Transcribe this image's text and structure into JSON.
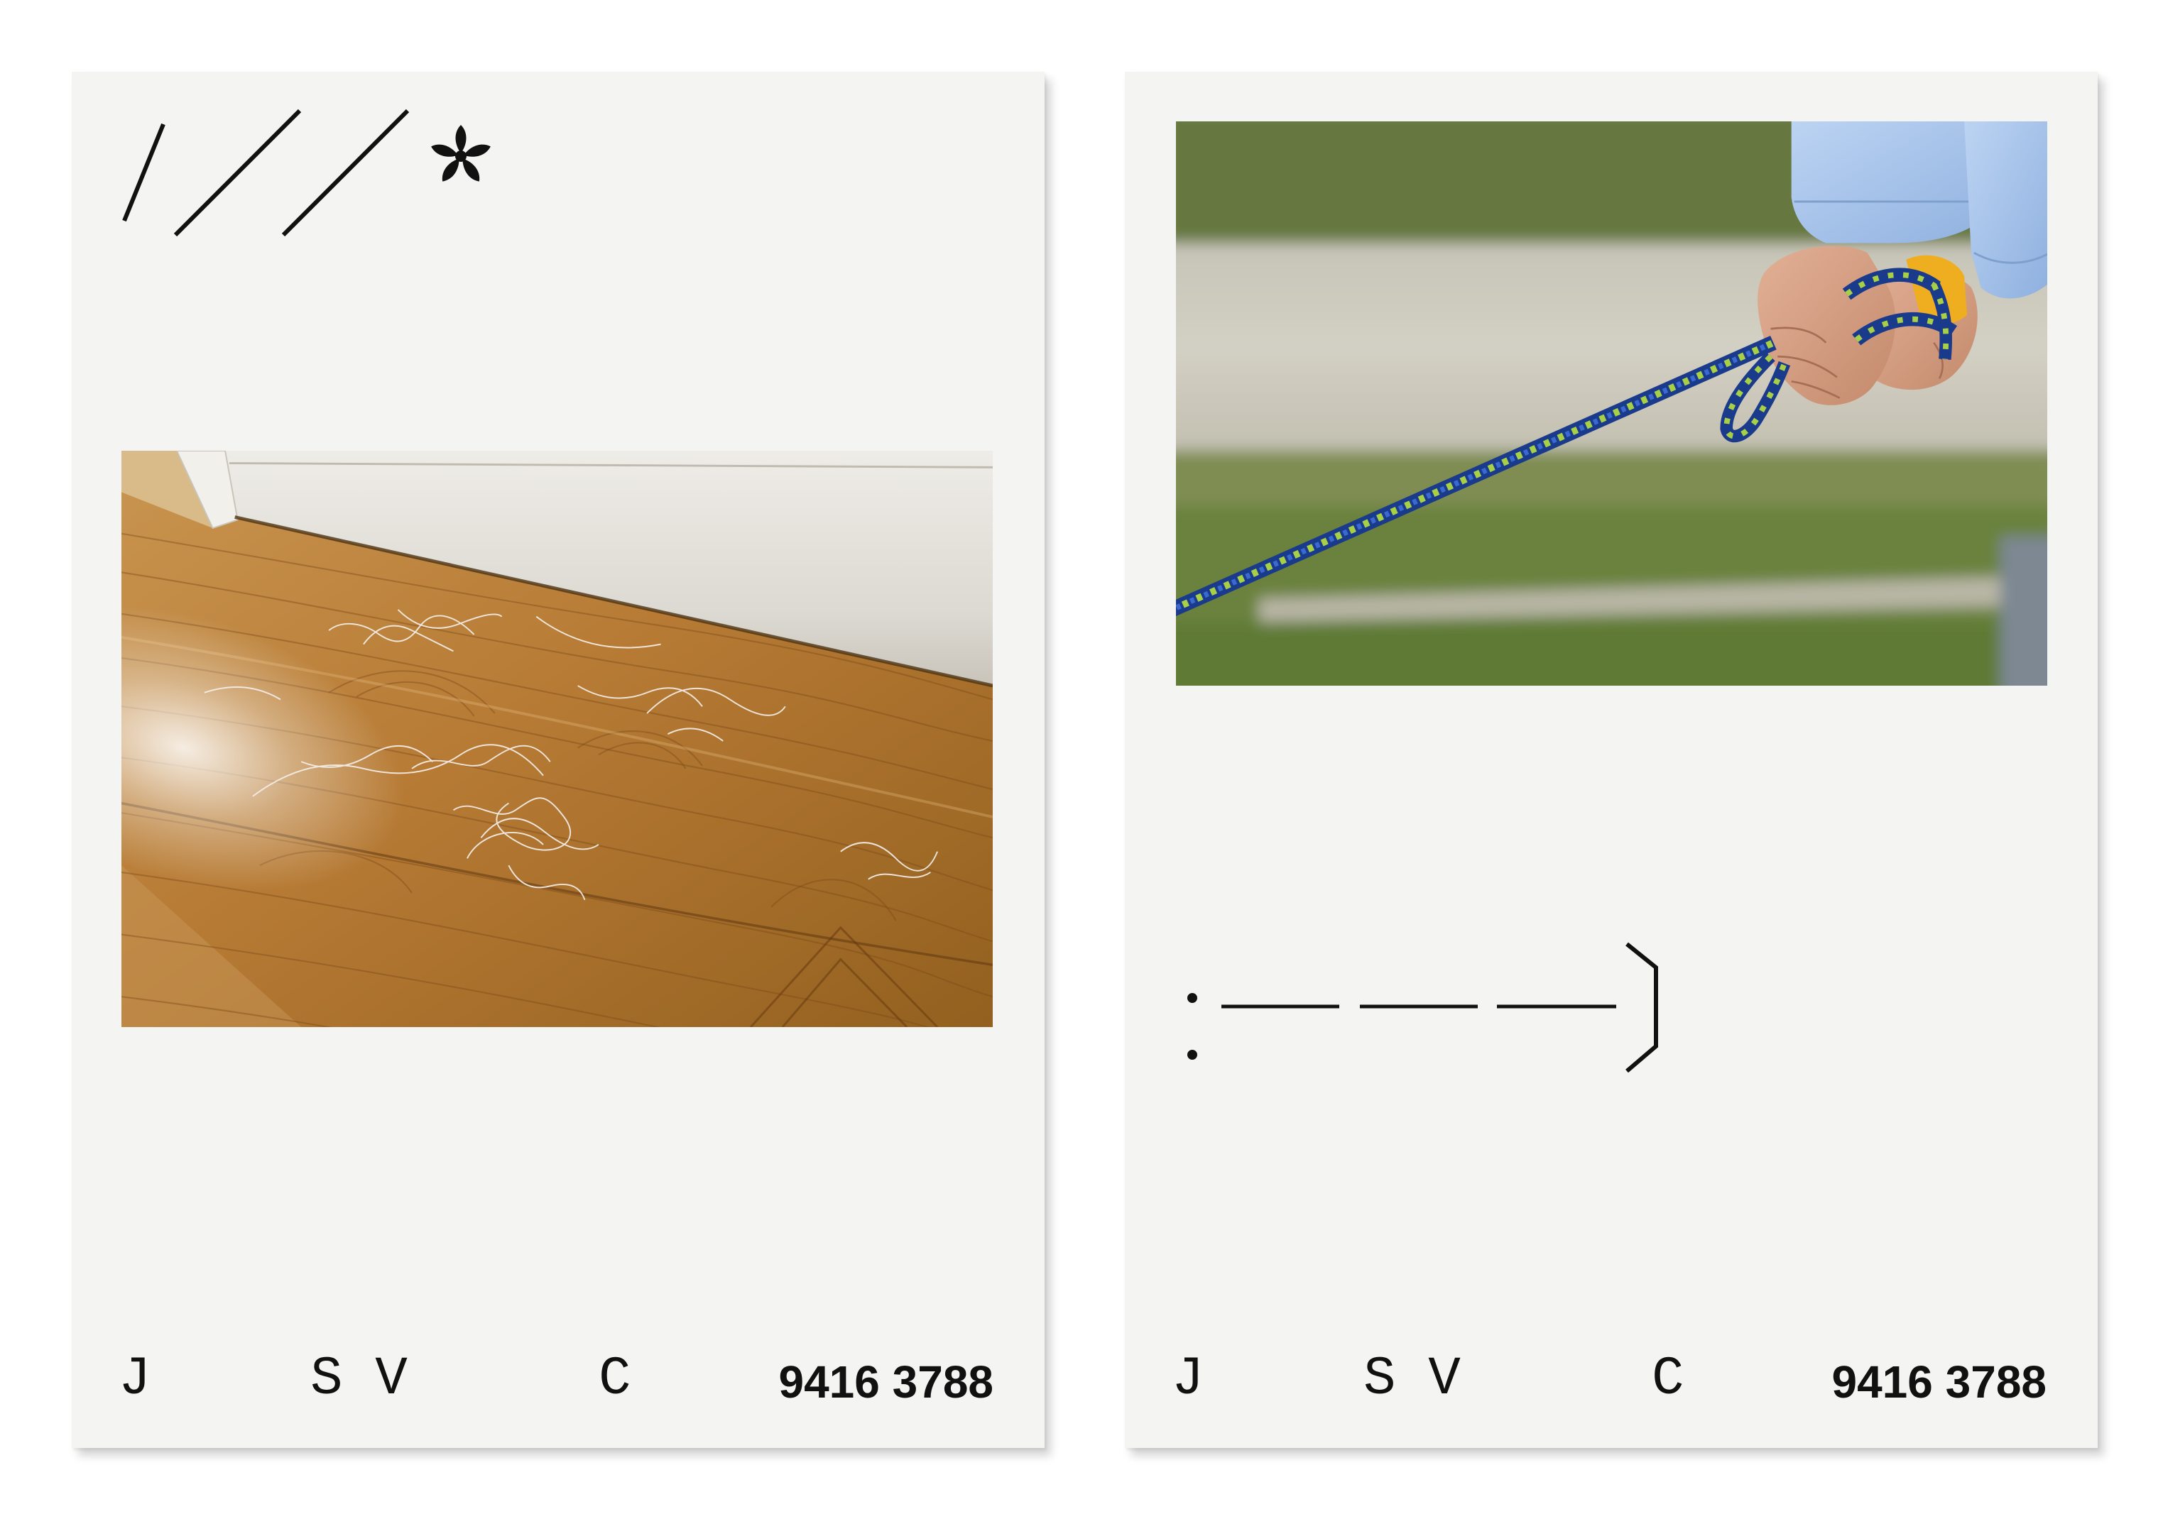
{
  "colors": {
    "page_background": "#ffffff",
    "card_background": "#f4f4f3",
    "ink": "#111111"
  },
  "cards": [
    {
      "mark_icon": "slashes-asterisk-mark",
      "footer": {
        "j": "J",
        "sv": "S V",
        "c": "C",
        "number": "9416 3788"
      }
    },
    {
      "mark_icon": "colon-dashes-bracket-mark",
      "footer": {
        "j": "J",
        "sv": "S V",
        "c": "C",
        "number": "9416 3788"
      }
    }
  ]
}
